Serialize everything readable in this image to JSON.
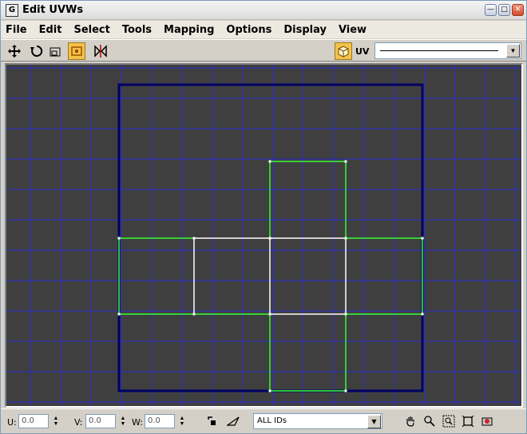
{
  "window": {
    "title": "Edit UVWs",
    "app_icon_glyph": "G"
  },
  "menu": [
    "File",
    "Edit",
    "Select",
    "Tools",
    "Mapping",
    "Options",
    "Display",
    "View"
  ],
  "toolbar": {
    "tools": [
      {
        "name": "move-icon",
        "active": false
      },
      {
        "name": "rotate-icon",
        "active": false
      },
      {
        "name": "scale-icon",
        "active": false
      },
      {
        "name": "freeform-icon",
        "active": true
      },
      {
        "name": "mirror-icon",
        "active": false
      }
    ],
    "uv_label": "UV",
    "uv_select_value": ""
  },
  "viewport": {
    "background": "#3f3f3f",
    "grid_color": "#2b2bd6",
    "bounds_color": "#000066",
    "edge_color": "#33ff33",
    "selected_edge_color": "#ffffff"
  },
  "status": {
    "u_label": "U:",
    "u_value": "0.0",
    "v_label": "V:",
    "v_value": "0.0",
    "w_label": "W:",
    "w_value": "0.0",
    "ids_value": "ALL IDs"
  }
}
